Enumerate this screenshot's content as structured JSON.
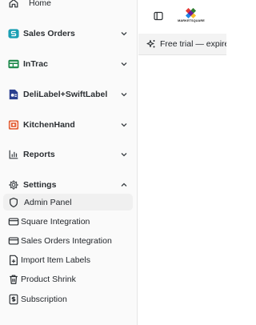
{
  "sidebar": {
    "top_item": {
      "label": "Home",
      "icon": "home-icon"
    },
    "sections": [
      {
        "label": "Sales Orders",
        "icon": "sales-orders-app-icon",
        "expanded": false
      },
      {
        "label": "InTrac",
        "icon": "intrac-app-icon",
        "expanded": false
      },
      {
        "label": "DeliLabel+SwiftLabel",
        "icon": "delilabel-app-icon",
        "expanded": false
      },
      {
        "label": "KitchenHand",
        "icon": "kitchenhand-app-icon",
        "expanded": false
      },
      {
        "label": "Reports",
        "icon": "bar-chart-icon",
        "expanded": false
      },
      {
        "label": "Settings",
        "icon": "gear-icon",
        "expanded": true
      }
    ],
    "settings_items": [
      {
        "label": "Admin Panel",
        "icon": "shield-icon",
        "active": true
      },
      {
        "label": "Square Integration",
        "icon": "credit-card-icon",
        "active": false
      },
      {
        "label": "Sales Orders Integration",
        "icon": "credit-card-icon",
        "active": false
      },
      {
        "label": "Import Item Labels",
        "icon": "file-plus-icon",
        "active": false
      },
      {
        "label": "Product Shrink",
        "icon": "trash-icon",
        "active": false
      },
      {
        "label": "Subscription",
        "icon": "dollar-receipt-icon",
        "active": false
      }
    ]
  },
  "topbar": {
    "logo_text": "MARKETSQUARE",
    "toggle_icon": "sidebar-toggle-icon"
  },
  "banner": {
    "text": "Free trial — expires",
    "icon": "sparkle-icon"
  },
  "colors": {
    "sidebar_bg": "#fafafa",
    "active_bg": "#f0f0f0",
    "banner_bg": "#f3f3f3",
    "sales_orders_icon": "#1a9fb3",
    "intrac_icon": "#1f8a4c",
    "delilabel_icon": "#2a3f8f",
    "kitchenhand_icon": "#e4623a"
  }
}
